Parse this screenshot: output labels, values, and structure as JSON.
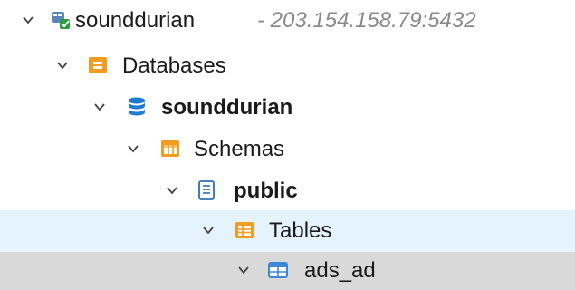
{
  "tree": {
    "server": {
      "name": "sounddurian",
      "address": "- 203.154.158.79:5432",
      "icon": "postgres-server-connected-icon"
    },
    "databases_folder": {
      "label": "Databases",
      "icon": "folder-databases-icon"
    },
    "database": {
      "label": "sounddurian",
      "icon": "database-icon"
    },
    "schemas_folder": {
      "label": "Schemas",
      "icon": "folder-schemas-icon"
    },
    "schema": {
      "label": "public",
      "icon": "schema-icon"
    },
    "tables_folder": {
      "label": "Tables",
      "icon": "folder-tables-icon"
    },
    "table": {
      "label": "ads_ad",
      "icon": "table-icon"
    }
  },
  "colors": {
    "hover_row": "#e5f3ff",
    "selected_row": "#d9d9d9",
    "folder_orange": "#f39c1f",
    "database_blue": "#1f7ad1",
    "table_blue": "#3a88d6",
    "address_gray": "#8a8a8a"
  }
}
